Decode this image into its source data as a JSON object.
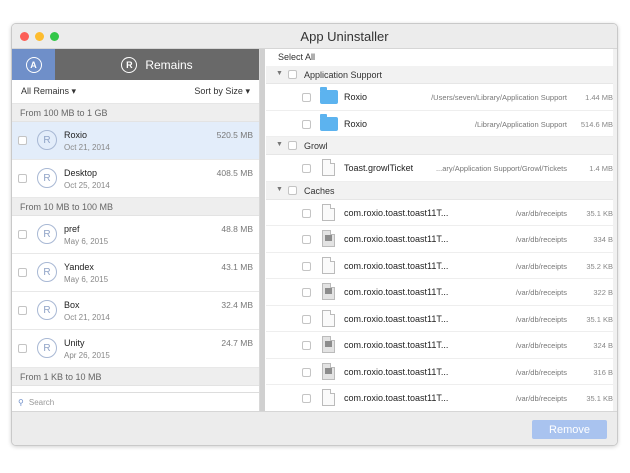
{
  "window": {
    "title": "App Uninstaller"
  },
  "left": {
    "tab_remains": "Remains",
    "filter": {
      "left": "All Remains",
      "right": "Sort by Size"
    },
    "groups": [
      {
        "header": "From 100 MB to 1 GB",
        "items": [
          {
            "name": "Roxio",
            "date": "Oct 21, 2014",
            "size": "520.5 MB",
            "selected": true
          },
          {
            "name": "Desktop",
            "date": "Oct 25, 2014",
            "size": "408.5 MB"
          }
        ]
      },
      {
        "header": "From 10 MB to 100 MB",
        "items": [
          {
            "name": "pref",
            "date": "May 6, 2015",
            "size": "48.8 MB"
          },
          {
            "name": "Yandex",
            "date": "May 6, 2015",
            "size": "43.1 MB"
          },
          {
            "name": "Box",
            "date": "Oct 21, 2014",
            "size": "32.4 MB"
          },
          {
            "name": "Unity",
            "date": "Apr 26, 2015",
            "size": "24.7 MB"
          }
        ]
      },
      {
        "header": "From 1 KB to 10 MB",
        "items": []
      }
    ],
    "search_placeholder": "Search"
  },
  "right": {
    "select_all": "Select All",
    "sections": [
      {
        "name": "Application Support",
        "rows": [
          {
            "icon": "folder",
            "name": "Roxio",
            "path": "/Users/seven/Library/Application Support",
            "size": "1.44 MB"
          },
          {
            "icon": "folder",
            "name": "Roxio",
            "path": "/Library/Application Support",
            "size": "514.6 MB"
          }
        ]
      },
      {
        "name": "Growl",
        "rows": [
          {
            "icon": "doc",
            "name": "Toast.growlTicket",
            "path": "...ary/Application Support/Growl/Tickets",
            "size": "1.4 MB"
          }
        ]
      },
      {
        "name": "Caches",
        "rows": [
          {
            "icon": "doc",
            "name": "com.roxio.toast.toast11T...",
            "path": "/var/db/receipts",
            "size": "35.1 KB"
          },
          {
            "icon": "exec",
            "name": "com.roxio.toast.toast11T...",
            "path": "/var/db/receipts",
            "size": "334 B"
          },
          {
            "icon": "doc",
            "name": "com.roxio.toast.toast11T...",
            "path": "/var/db/receipts",
            "size": "35.2 KB"
          },
          {
            "icon": "exec",
            "name": "com.roxio.toast.toast11T...",
            "path": "/var/db/receipts",
            "size": "322 B"
          },
          {
            "icon": "doc",
            "name": "com.roxio.toast.toast11T...",
            "path": "/var/db/receipts",
            "size": "35.1 KB"
          },
          {
            "icon": "exec",
            "name": "com.roxio.toast.toast11T...",
            "path": "/var/db/receipts",
            "size": "324 B"
          },
          {
            "icon": "exec",
            "name": "com.roxio.toast.toast11T...",
            "path": "/var/db/receipts",
            "size": "316 B"
          },
          {
            "icon": "doc",
            "name": "com.roxio.toast.toast11T...",
            "path": "/var/db/receipts",
            "size": "35.1 KB"
          }
        ]
      }
    ]
  },
  "remove_button": "Remove",
  "colors": {
    "accent": "#6f8fc9",
    "remove": "#a9c3ef",
    "folder": "#5cb3ef"
  }
}
